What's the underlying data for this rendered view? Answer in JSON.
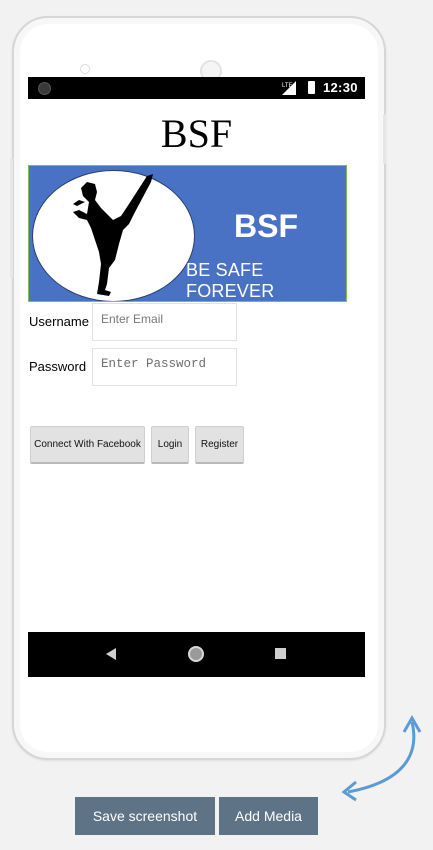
{
  "status_bar": {
    "time": "12:30",
    "network": "LTE"
  },
  "app": {
    "title": "BSF",
    "banner": {
      "title": "BSF",
      "tagline": "BE SAFE FOREVER"
    },
    "username": {
      "label": "Username",
      "placeholder": "Enter Email"
    },
    "password": {
      "label": "Password",
      "placeholder": "Enter Password"
    },
    "buttons": {
      "facebook": "Connect With Facebook",
      "login": "Login",
      "register": "Register"
    }
  },
  "toolbar": {
    "save_screenshot": "Save screenshot",
    "add_media": "Add Media"
  },
  "colors": {
    "banner_blue": "#4a72c4",
    "tool_button": "#5e7386",
    "rotate_arrow": "#5b9bd5"
  }
}
